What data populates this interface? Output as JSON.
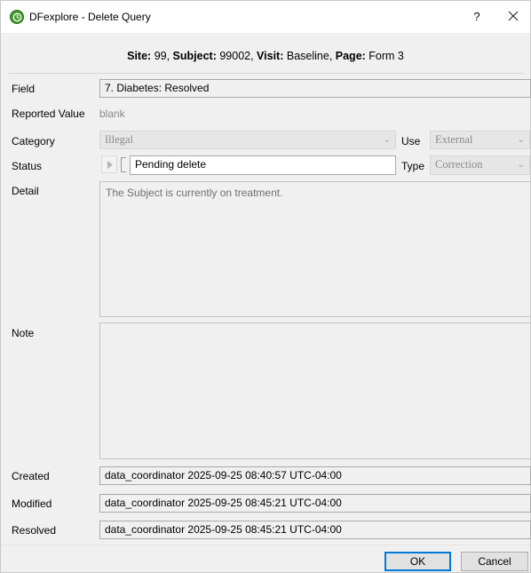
{
  "window": {
    "title": "DFexplore - Delete Query",
    "help": "?"
  },
  "header": {
    "site_label": "Site:",
    "site_value": " 99, ",
    "subject_label": "Subject:",
    "subject_value": " 99002, ",
    "visit_label": "Visit:",
    "visit_value": " Baseline, ",
    "page_label": "Page:",
    "page_value": " Form 3"
  },
  "form": {
    "field": {
      "label": "Field",
      "value": "7. Diabetes: Resolved"
    },
    "reported_value": {
      "label": "Reported Value",
      "value": "blank"
    },
    "category": {
      "label": "Category",
      "value": "Illegal"
    },
    "use": {
      "label": "Use",
      "value": "External"
    },
    "status": {
      "label": "Status",
      "value": "Pending delete"
    },
    "type": {
      "label": "Type",
      "value": "Correction"
    },
    "detail": {
      "label": "Detail",
      "value": "The Subject is currently on treatment."
    },
    "note": {
      "label": "Note",
      "value": ""
    },
    "created": {
      "label": "Created",
      "value": "data_coordinator 2025-09-25 08:40:57 UTC-04:00"
    },
    "modified": {
      "label": "Modified",
      "value": "data_coordinator 2025-09-25 08:45:21 UTC-04:00"
    },
    "resolved": {
      "label": "Resolved",
      "value": "data_coordinator 2025-09-25 08:45:21 UTC-04:00"
    }
  },
  "buttons": {
    "ok": "OK",
    "cancel": "Cancel"
  }
}
